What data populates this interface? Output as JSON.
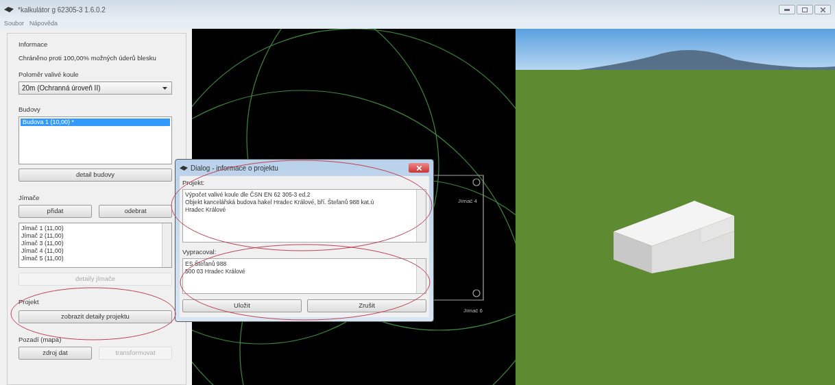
{
  "window": {
    "title": "*kalkulátor g 62305-3 1.6.0.2"
  },
  "menu": [
    {
      "label": "Soubor"
    },
    {
      "label": "Nápověda"
    }
  ],
  "left_panel": {
    "info_heading": "Informace",
    "info_text": "Chráněno proti 100,00% možných úderů blesku",
    "radius_label": "Poloměr valivé koule",
    "radius_select": "20m (Ochranná úroveň II)",
    "buildings_label": "Budovy",
    "buildings": [
      {
        "label": "Budova 1 (10,00) *",
        "selected": true
      }
    ],
    "building_detail_button": "detail budovy",
    "rods_label": "Jímače",
    "add_button": "přidat",
    "remove_button": "odebrat",
    "rods": [
      {
        "label": "Jímač 1 (11,00)",
        "selected": false
      },
      {
        "label": "Jímač 2 (11,00)",
        "selected": false
      },
      {
        "label": "Jímač 3 (11,00)",
        "selected": false
      },
      {
        "label": "Jímač 4 (11,00)",
        "selected": false
      },
      {
        "label": "Jímač 5 (11,00)",
        "selected": false
      }
    ],
    "rod_detail_button": {
      "label": "detaily jímače",
      "disabled": true
    },
    "project_label": "Projekt",
    "project_button": "zobrazit detaily projektu",
    "background_label": "Pozadí (mapa)",
    "source_button": {
      "label": "zdroj dat",
      "disabled": false
    },
    "transform_button": {
      "label": "transformovat",
      "disabled": true
    }
  },
  "canvas": {
    "labels": [
      "Jímač 4",
      "Jímač 6"
    ]
  },
  "dialog": {
    "title": "Dialog - informace o projektu",
    "project_label": "Projekt:",
    "project_text": "Výpočet valivé koule dle ČSN EN 62 305-3 ed.2\nObjekt kancelářská budova hakel Hradec Králové, bří. Štefanů 988 kat.ú\nHradec Králové",
    "author_label": "Vypracoval:",
    "author_text": "ES Štefanů 988\n500 03 Hradec Králové",
    "save_button": "Uložit",
    "cancel_button": "Zrušit"
  }
}
